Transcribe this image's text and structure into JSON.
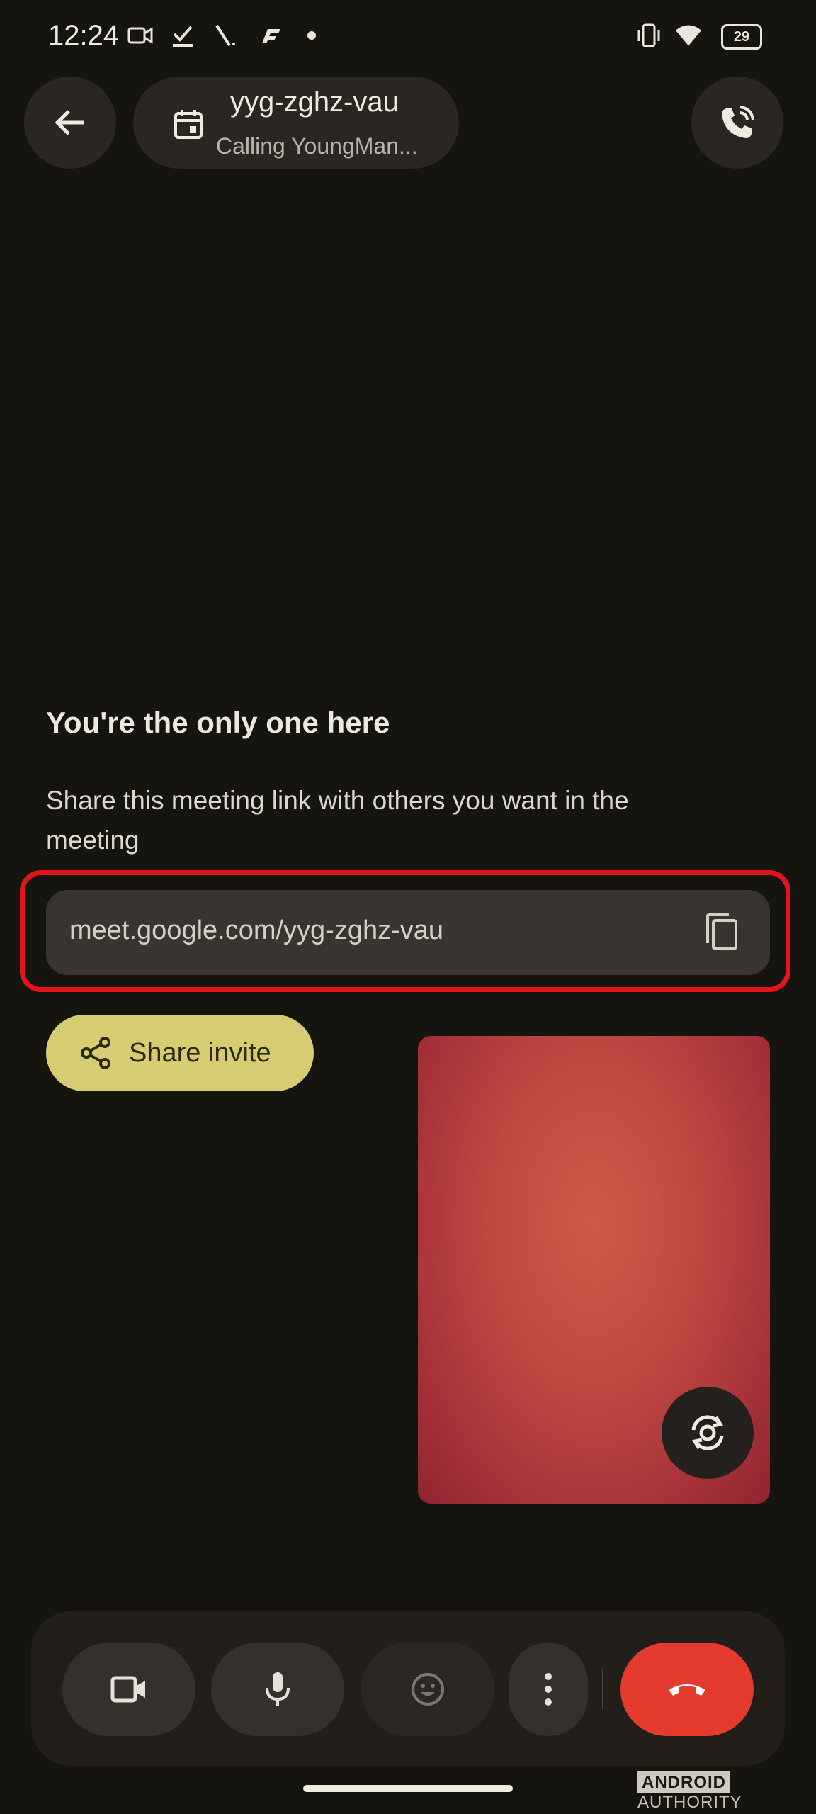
{
  "status_bar": {
    "time": "12:24",
    "battery": "29",
    "icons": [
      "video-icon",
      "check-icon",
      "tool-icon",
      "app-icon",
      "dot-icon",
      "vibrate-icon",
      "wifi-icon",
      "battery-icon"
    ]
  },
  "header": {
    "meeting_code": "yyg-zghz-vau",
    "subtitle": "Calling YoungMan..."
  },
  "content": {
    "heading": "You're the only one here",
    "description": "Share this meeting link with others you want in the meeting",
    "link": "meet.google.com/yyg-zghz-vau",
    "share_label": "Share invite"
  },
  "colors": {
    "background": "#16140f",
    "share_button": "#d6cd73",
    "end_call": "#e53a2e",
    "highlight": "#e4141b"
  },
  "watermark": {
    "brand": "ANDROID",
    "suffix": "AUTHORITY"
  }
}
